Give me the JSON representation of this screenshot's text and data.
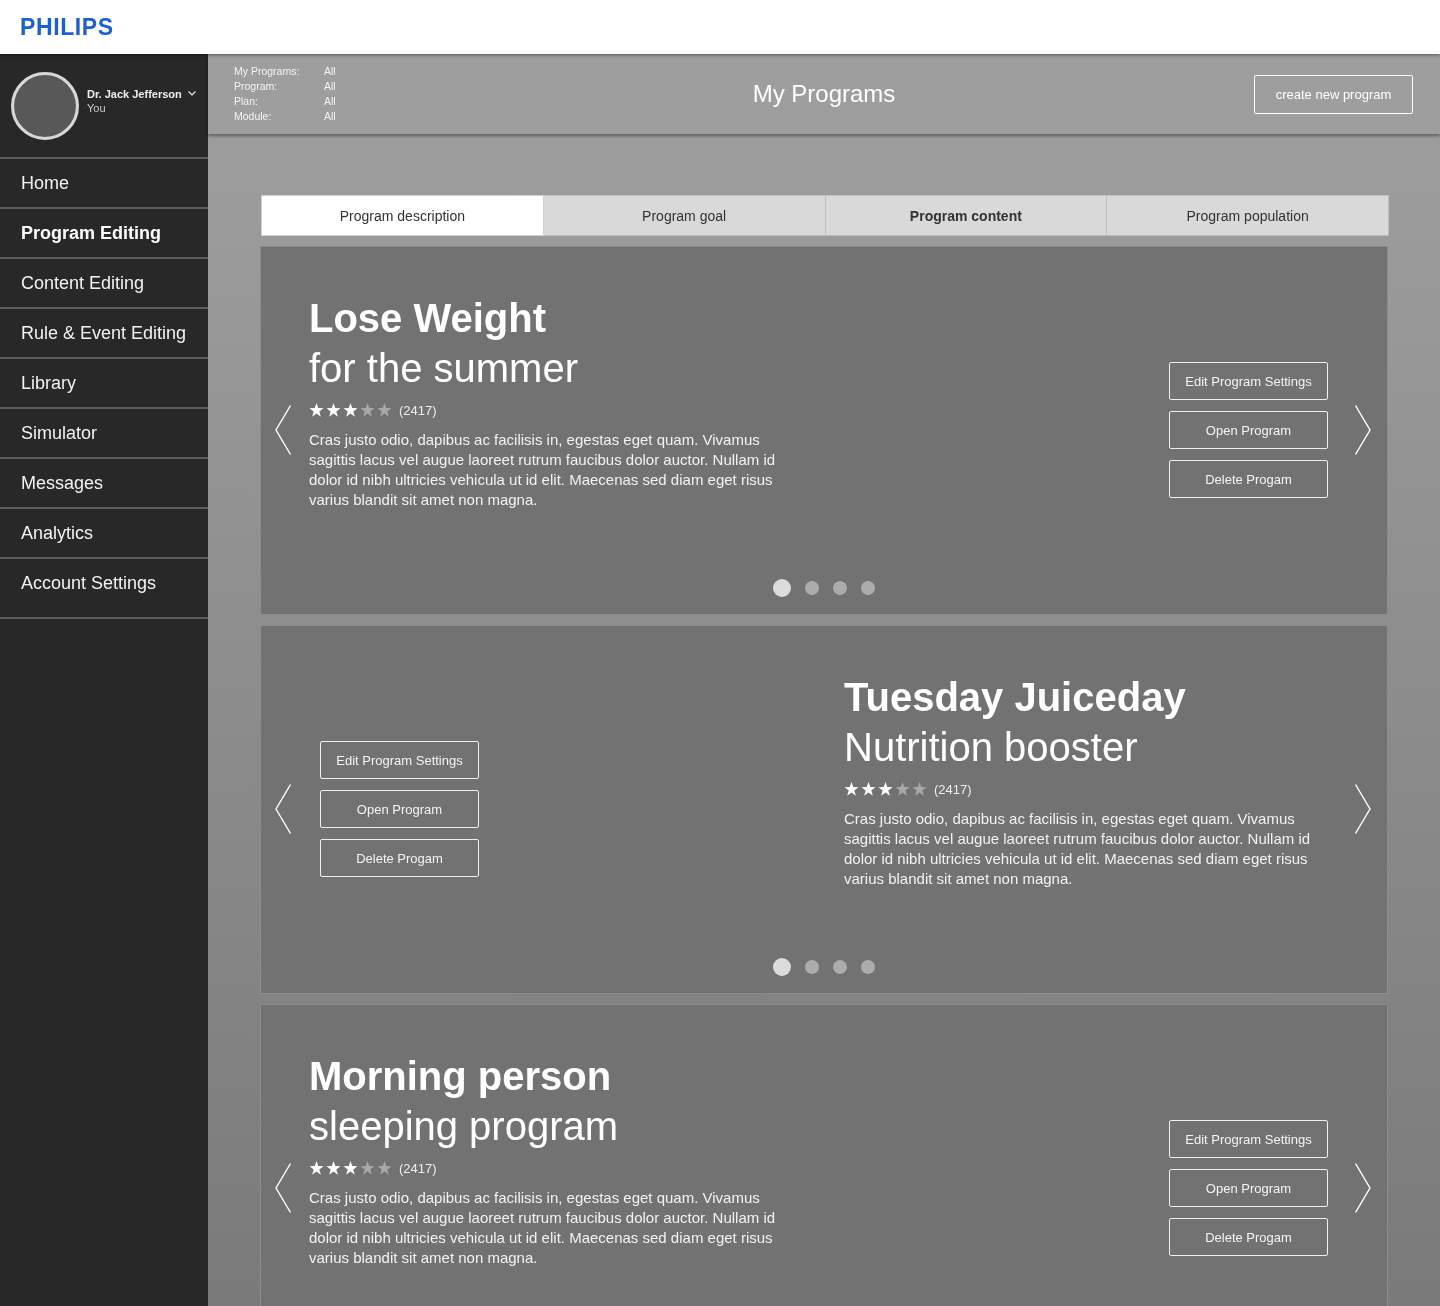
{
  "header": {
    "logo": "PHILIPS"
  },
  "sidebar": {
    "user": {
      "name": "Dr. Jack Jefferson",
      "role": "You"
    },
    "items": [
      {
        "label": "Home",
        "selected": false
      },
      {
        "label": "Program Editing",
        "selected": true
      },
      {
        "label": "Content Editing",
        "selected": false
      },
      {
        "label": "Rule & Event Editing",
        "selected": false
      },
      {
        "label": "Library",
        "selected": false
      },
      {
        "label": "Simulator",
        "selected": false
      },
      {
        "label": "Messages",
        "selected": false
      },
      {
        "label": "Analytics",
        "selected": false
      },
      {
        "label": "Account Settings",
        "selected": false
      }
    ]
  },
  "top_bar": {
    "filters": [
      {
        "label": "My Programs:",
        "value": "All"
      },
      {
        "label": "Program:",
        "value": "All"
      },
      {
        "label": "Plan:",
        "value": "All"
      },
      {
        "label": "Module:",
        "value": "All"
      }
    ],
    "title": "My Programs",
    "create_button": "create new program"
  },
  "tabs": [
    {
      "label": "Program description",
      "selected": true,
      "bold": false
    },
    {
      "label": "Program goal",
      "selected": false,
      "bold": false
    },
    {
      "label": "Program content",
      "selected": false,
      "bold": true
    },
    {
      "label": "Program population",
      "selected": false,
      "bold": false
    }
  ],
  "programs": [
    {
      "kind": "standard",
      "title": "Lose Weight",
      "subtitle": "for the summer",
      "stars": 3,
      "rating_count": "(2417)",
      "description": "Cras justo odio, dapibus ac facilisis in, egestas eget quam. Vivamus sagittis lacus vel augue laoreet rutrum faucibus dolor auctor. Nullam id dolor id nibh ultricies vehicula ut id elit. Maecenas sed diam eget risus varius blandit sit amet non magna.",
      "buttons": [
        "Edit Program Settings",
        "Open Program",
        "Delete Progam"
      ],
      "dots": [
        {
          "selected": true
        },
        {
          "selected": false
        },
        {
          "selected": false
        },
        {
          "selected": false
        }
      ]
    },
    {
      "kind": "mirrored",
      "title": "Tuesday Juiceday",
      "subtitle": "Nutrition booster",
      "stars": 3,
      "rating_count": "(2417)",
      "description": "Cras justo odio, dapibus ac facilisis in, egestas eget quam. Vivamus sagittis lacus vel augue laoreet rutrum faucibus dolor auctor. Nullam id dolor id nibh ultricies vehicula ut id elit. Maecenas sed diam eget risus varius blandit sit amet non magna.",
      "buttons": [
        "Edit Program Settings",
        "Open Program",
        "Delete Progam"
      ],
      "dots": [
        {
          "selected": true
        },
        {
          "selected": false
        },
        {
          "selected": false
        },
        {
          "selected": false
        }
      ]
    },
    {
      "kind": "standard",
      "title": "Morning person",
      "subtitle": "sleeping program",
      "stars": 3,
      "rating_count": "(2417)",
      "description": "Cras justo odio, dapibus ac facilisis in, egestas eget quam. Vivamus sagittis lacus vel augue laoreet rutrum faucibus dolor auctor. Nullam id dolor id nibh ultricies vehicula ut id elit. Maecenas sed diam eget risus varius blandit sit amet non magna.",
      "buttons": [
        "Edit Program Settings",
        "Open Program",
        "Delete Progam"
      ]
    }
  ]
}
